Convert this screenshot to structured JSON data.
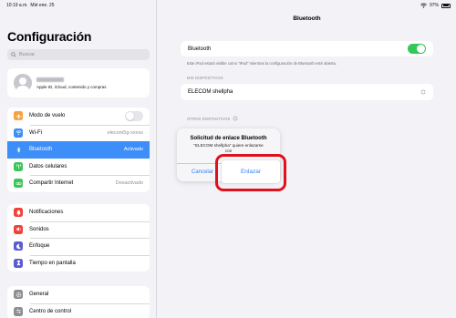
{
  "status": {
    "time": "10:19 a.m.",
    "date": "Mié ene. 25",
    "battery": "97%"
  },
  "sidebar": {
    "title": "Configuración",
    "search_placeholder": "Buscar",
    "profile": {
      "subtitle": "Apple ID, iCloud, contenido y compras"
    },
    "group1": [
      {
        "label": "Modo de vuelo",
        "value": "",
        "icon": "airplane-icon",
        "color": "#f7a23a"
      },
      {
        "label": "Wi-Fi",
        "value": "elecom5g-xxxxx",
        "icon": "wifi-icon",
        "color": "#3b8ff7"
      },
      {
        "label": "Bluetooth",
        "value": "Activado",
        "icon": "bluetooth-icon",
        "color": "#3b8ff7"
      },
      {
        "label": "Datos celulares",
        "value": "",
        "icon": "antenna-icon",
        "color": "#3ac75a"
      },
      {
        "label": "Compartir Internet",
        "value": "Desactivado",
        "icon": "link-icon",
        "color": "#3ac75a"
      }
    ],
    "group2": [
      {
        "label": "Notificaciones",
        "icon": "bell-icon",
        "color": "#f2423a"
      },
      {
        "label": "Sonidos",
        "icon": "speaker-icon",
        "color": "#f2423a"
      },
      {
        "label": "Enfoque",
        "icon": "moon-icon",
        "color": "#5b5bd6"
      },
      {
        "label": "Tiempo en pantalla",
        "icon": "hourglass-icon",
        "color": "#5b5bd6"
      }
    ],
    "group3": [
      {
        "label": "General",
        "icon": "gear-icon",
        "color": "#8e8e93"
      },
      {
        "label": "Centro de control",
        "icon": "control-center-icon",
        "color": "#8e8e93"
      }
    ]
  },
  "main": {
    "title": "Bluetooth",
    "bluetooth_label": "Bluetooth",
    "note": "Este iPad estará visible como \"iPad\" mientras la configuración de Bluetooth esté abierta.",
    "my_devices_header": "MIS DISPOSITIVOS",
    "device_name": "ELECOM shellpha",
    "other_devices_header": "OTROS DISPOSITIVOS"
  },
  "alert": {
    "title": "Solicitud de enlace Bluetooth",
    "message_line1": "\"ELECOM shellpha\" quiere enlazarse",
    "message_line2": "con",
    "cancel_label": "Cancelar",
    "pair_label": "Enlazar"
  },
  "colors": {
    "accent": "#2f7ff6",
    "active_row": "#3d8ef8",
    "toggle_on": "#34c759",
    "highlight": "#e0101c"
  }
}
